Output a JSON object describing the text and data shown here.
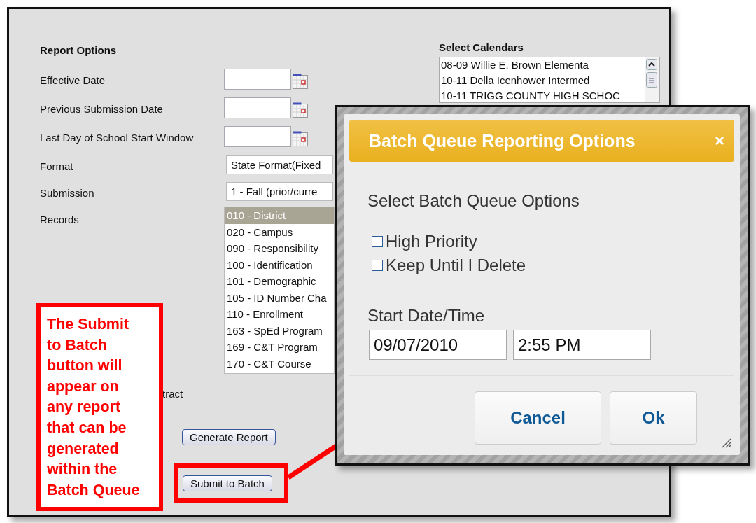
{
  "report_options": {
    "title": "Report Options",
    "fields": [
      {
        "kind": "date",
        "label": "Effective Date"
      },
      {
        "kind": "date",
        "label": "Previous Submission Date"
      },
      {
        "kind": "date",
        "label": "Last Day of School Start Window"
      },
      {
        "kind": "select",
        "label": "Format",
        "value": "State Format(Fixed"
      },
      {
        "kind": "select",
        "label": "Submission",
        "value": "1 - Fall (prior/curre"
      },
      {
        "kind": "list",
        "label": "Records",
        "items": [
          {
            "label": "010 - District",
            "selected": true
          },
          {
            "label": "020 - Campus",
            "selected": false
          },
          {
            "label": "090 - Responsibility",
            "selected": false
          },
          {
            "label": "100 - Identification",
            "selected": false
          },
          {
            "label": "101 - Demographic",
            "selected": false
          },
          {
            "label": "105 - ID Number Cha",
            "selected": false
          },
          {
            "label": "110 - Enrollment",
            "selected": false
          },
          {
            "label": "163 - SpEd Program",
            "selected": false
          },
          {
            "label": "169 - C&T Program",
            "selected": false
          },
          {
            "label": "170 - C&T Course",
            "selected": false
          }
        ]
      }
    ]
  },
  "extract_fragment": "tract",
  "buttons": [
    {
      "label": "Generate Report",
      "highlighted": false
    },
    {
      "label": "Submit to Batch",
      "highlighted": true
    }
  ],
  "calendars": {
    "title": "Select Calendars",
    "items": [
      "08-09 Willie E. Brown Elementa",
      "10-11 Della Icenhower Intermed",
      "10-11 TRIGG COUNTY HIGH SCHOC"
    ]
  },
  "dialog": {
    "title": "Batch Queue Reporting Options",
    "close": "×",
    "section_title": "Select Batch Queue Options",
    "options": [
      {
        "label": "High Priority",
        "checked": false
      },
      {
        "label": "Keep Until I Delete",
        "checked": false
      }
    ],
    "start_label": "Start Date/Time",
    "date": "09/07/2010",
    "time": "2:55 PM",
    "buttons": [
      "Cancel",
      "Ok"
    ]
  },
  "callout": {
    "text": "The Submit to Batch button will appear on any report that can be generated within the Batch Queue"
  }
}
